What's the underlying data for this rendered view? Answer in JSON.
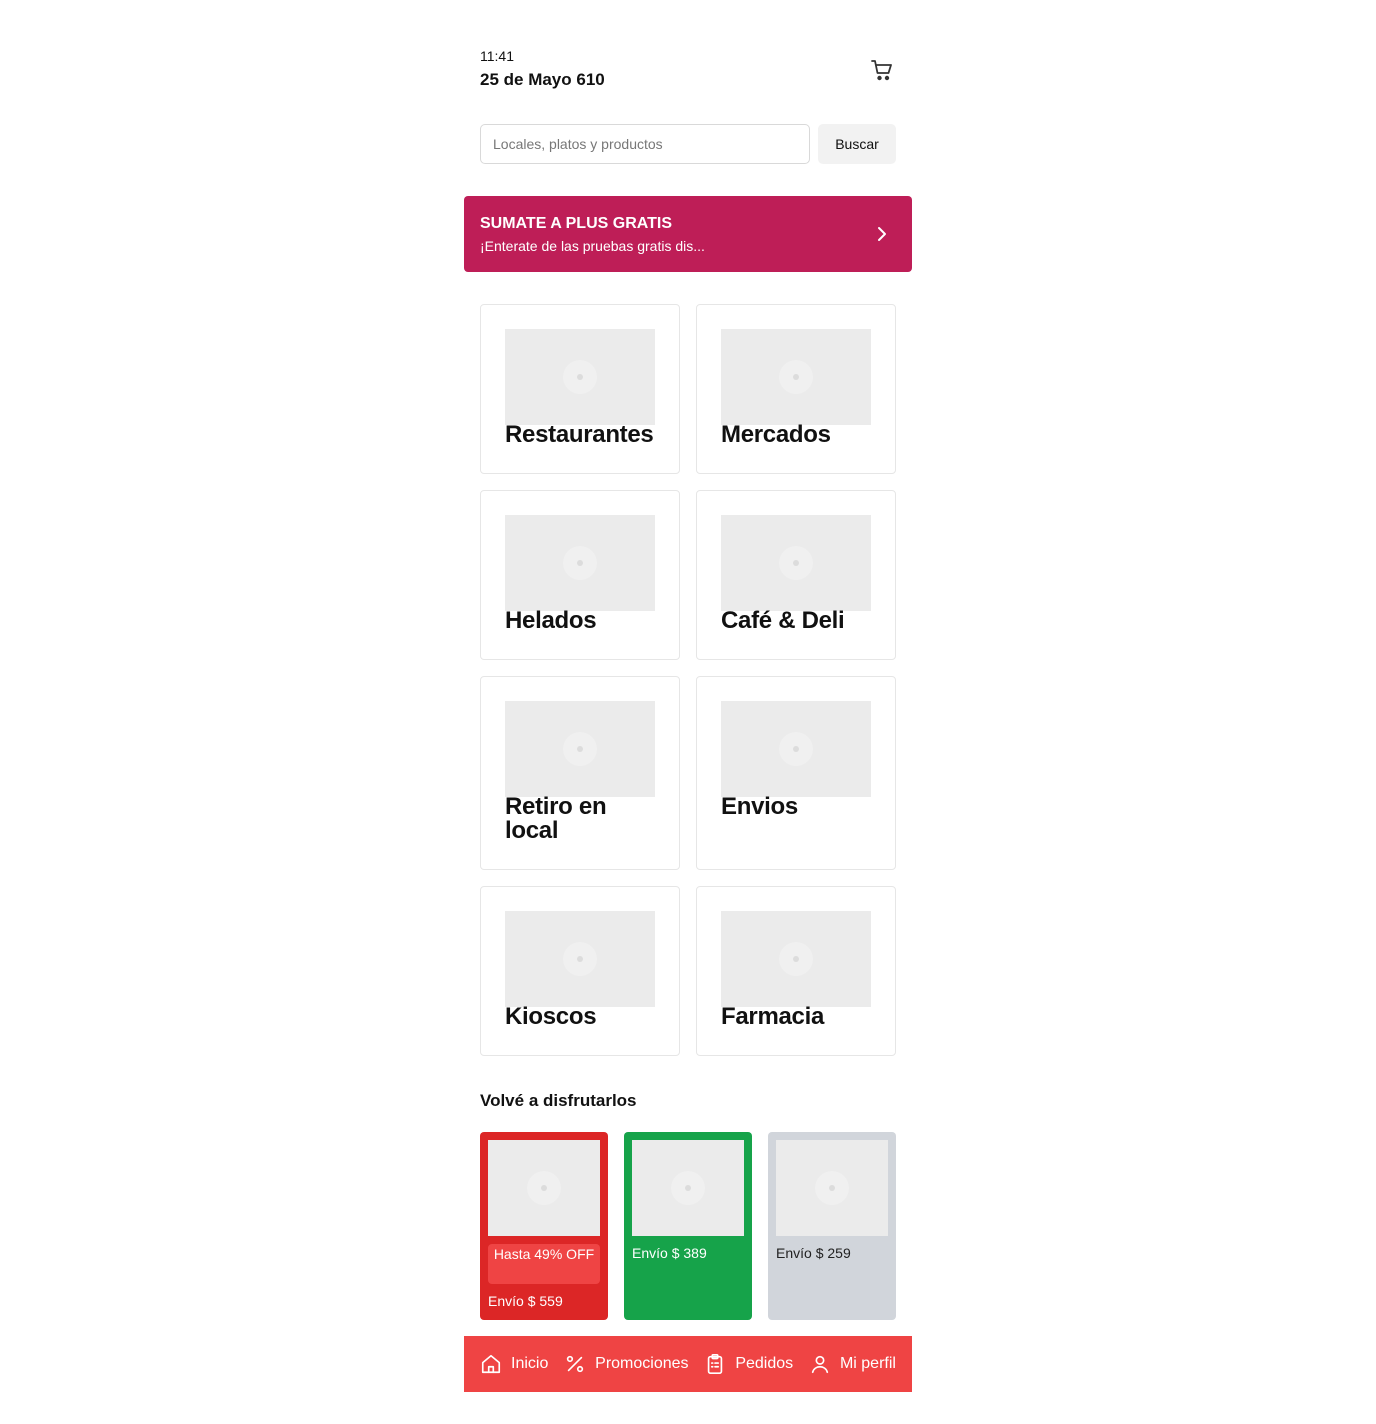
{
  "header": {
    "time": "11:41",
    "address": "25 de Mayo 610",
    "cart_icon": "cart-icon"
  },
  "search": {
    "placeholder": "Locales, platos y productos",
    "value": "",
    "button_label": "Buscar"
  },
  "banner": {
    "title": "SUMATE A PLUS GRATIS",
    "subtitle": "¡Enterate de las pruebas gratis dis...",
    "color": "#be1e57",
    "icon": "chevron-right-icon"
  },
  "categories": [
    {
      "label": "Restaurantes"
    },
    {
      "label": "Mercados"
    },
    {
      "label": "Helados"
    },
    {
      "label": "Café & Deli"
    },
    {
      "label": "Retiro en local"
    },
    {
      "label": "Envios"
    },
    {
      "label": "Kioscos"
    },
    {
      "label": "Farmacia"
    }
  ],
  "section": {
    "title": "Volvé a disfrutarlos"
  },
  "stores": [
    {
      "promo": "Hasta 49% OFF",
      "shipping": "Envío $ 559",
      "color": "#dc2626"
    },
    {
      "shipping": "Envío $ 389",
      "color": "#16a34a"
    },
    {
      "shipping": "Envío $ 259",
      "color": "#d1d5db"
    }
  ],
  "nav": {
    "color": "#ef4444",
    "items": [
      {
        "label": "Inicio",
        "icon": "home-icon"
      },
      {
        "label": "Promociones",
        "icon": "percent-icon"
      },
      {
        "label": "Pedidos",
        "icon": "clipboard-icon"
      },
      {
        "label": "Mi perfil",
        "icon": "user-icon"
      }
    ]
  }
}
